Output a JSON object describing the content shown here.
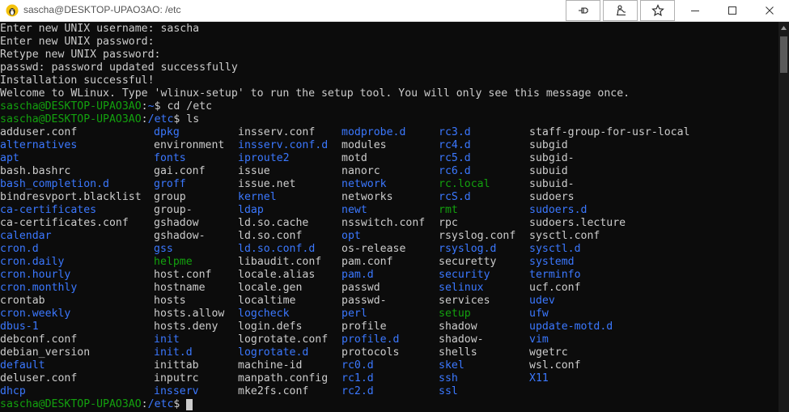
{
  "window": {
    "title": "sascha@DESKTOP-UPAO3AO: /etc",
    "title_buttons": [
      {
        "name": "pin-to-taskbar-button",
        "icon": "pin-icon"
      },
      {
        "name": "compact-overlay-button",
        "icon": "presenter-icon"
      },
      {
        "name": "favorite-button",
        "icon": "star-icon"
      }
    ],
    "controls": [
      "minimize",
      "maximize",
      "close"
    ]
  },
  "colors": {
    "background": "#0c0c0c",
    "text": "#cccccc",
    "user": "#13a10e",
    "path": "#3b78ff",
    "directory": "#3b78ff",
    "executable": "#13a10e"
  },
  "terminal": {
    "lines": [
      {
        "text": "Enter new UNIX username: sascha"
      },
      {
        "text": "Enter new UNIX password:"
      },
      {
        "text": "Retype new UNIX password:"
      },
      {
        "text": "passwd: password updated successfully"
      },
      {
        "text": "Installation successful!"
      },
      {
        "text": "Welcome to WLinux. Type 'wlinux-setup' to run the setup tool. You will only see this message once."
      }
    ],
    "prompts": [
      {
        "user": "sascha@DESKTOP-UPAO3AO",
        "sep": ":",
        "path": "~",
        "dollar": "$",
        "cmd": " cd /etc"
      },
      {
        "user": "sascha@DESKTOP-UPAO3AO",
        "sep": ":",
        "path": "/etc",
        "dollar": "$",
        "cmd": " ls"
      }
    ],
    "final_prompt": {
      "user": "sascha@DESKTOP-UPAO3AO",
      "sep": ":",
      "path": "/etc",
      "dollar": "$",
      "cmd": " "
    },
    "ls_rows": [
      [
        {
          "t": "adduser.conf",
          "k": "file"
        },
        {
          "t": "dpkg",
          "k": "dir"
        },
        {
          "t": "insserv.conf",
          "k": "file"
        },
        {
          "t": "modprobe.d",
          "k": "dir"
        },
        {
          "t": "rc3.d",
          "k": "dir"
        },
        {
          "t": "staff-group-for-usr-local",
          "k": "file"
        }
      ],
      [
        {
          "t": "alternatives",
          "k": "dir"
        },
        {
          "t": "environment",
          "k": "file"
        },
        {
          "t": "insserv.conf.d",
          "k": "dir"
        },
        {
          "t": "modules",
          "k": "file"
        },
        {
          "t": "rc4.d",
          "k": "dir"
        },
        {
          "t": "subgid",
          "k": "file"
        }
      ],
      [
        {
          "t": "apt",
          "k": "dir"
        },
        {
          "t": "fonts",
          "k": "dir"
        },
        {
          "t": "iproute2",
          "k": "dir"
        },
        {
          "t": "motd",
          "k": "file"
        },
        {
          "t": "rc5.d",
          "k": "dir"
        },
        {
          "t": "subgid-",
          "k": "file"
        }
      ],
      [
        {
          "t": "bash.bashrc",
          "k": "file"
        },
        {
          "t": "gai.conf",
          "k": "file"
        },
        {
          "t": "issue",
          "k": "file"
        },
        {
          "t": "nanorc",
          "k": "file"
        },
        {
          "t": "rc6.d",
          "k": "dir"
        },
        {
          "t": "subuid",
          "k": "file"
        }
      ],
      [
        {
          "t": "bash_completion.d",
          "k": "dir"
        },
        {
          "t": "groff",
          "k": "dir"
        },
        {
          "t": "issue.net",
          "k": "file"
        },
        {
          "t": "network",
          "k": "dir"
        },
        {
          "t": "rc.local",
          "k": "exe"
        },
        {
          "t": "subuid-",
          "k": "file"
        }
      ],
      [
        {
          "t": "bindresvport.blacklist",
          "k": "file"
        },
        {
          "t": "group",
          "k": "file"
        },
        {
          "t": "kernel",
          "k": "dir"
        },
        {
          "t": "networks",
          "k": "file"
        },
        {
          "t": "rcS.d",
          "k": "dir"
        },
        {
          "t": "sudoers",
          "k": "file"
        }
      ],
      [
        {
          "t": "ca-certificates",
          "k": "dir"
        },
        {
          "t": "group-",
          "k": "file"
        },
        {
          "t": "ldap",
          "k": "dir"
        },
        {
          "t": "newt",
          "k": "dir"
        },
        {
          "t": "rmt",
          "k": "exe"
        },
        {
          "t": "sudoers.d",
          "k": "dir"
        }
      ],
      [
        {
          "t": "ca-certificates.conf",
          "k": "file"
        },
        {
          "t": "gshadow",
          "k": "file"
        },
        {
          "t": "ld.so.cache",
          "k": "file"
        },
        {
          "t": "nsswitch.conf",
          "k": "file"
        },
        {
          "t": "rpc",
          "k": "file"
        },
        {
          "t": "sudoers.lecture",
          "k": "file"
        }
      ],
      [
        {
          "t": "calendar",
          "k": "dir"
        },
        {
          "t": "gshadow-",
          "k": "file"
        },
        {
          "t": "ld.so.conf",
          "k": "file"
        },
        {
          "t": "opt",
          "k": "dir"
        },
        {
          "t": "rsyslog.conf",
          "k": "file"
        },
        {
          "t": "sysctl.conf",
          "k": "file"
        }
      ],
      [
        {
          "t": "cron.d",
          "k": "dir"
        },
        {
          "t": "gss",
          "k": "dir"
        },
        {
          "t": "ld.so.conf.d",
          "k": "dir"
        },
        {
          "t": "os-release",
          "k": "file"
        },
        {
          "t": "rsyslog.d",
          "k": "dir"
        },
        {
          "t": "sysctl.d",
          "k": "dir"
        }
      ],
      [
        {
          "t": "cron.daily",
          "k": "dir"
        },
        {
          "t": "helpme",
          "k": "exe"
        },
        {
          "t": "libaudit.conf",
          "k": "file"
        },
        {
          "t": "pam.conf",
          "k": "file"
        },
        {
          "t": "securetty",
          "k": "file"
        },
        {
          "t": "systemd",
          "k": "dir"
        }
      ],
      [
        {
          "t": "cron.hourly",
          "k": "dir"
        },
        {
          "t": "host.conf",
          "k": "file"
        },
        {
          "t": "locale.alias",
          "k": "file"
        },
        {
          "t": "pam.d",
          "k": "dir"
        },
        {
          "t": "security",
          "k": "dir"
        },
        {
          "t": "terminfo",
          "k": "dir"
        }
      ],
      [
        {
          "t": "cron.monthly",
          "k": "dir"
        },
        {
          "t": "hostname",
          "k": "file"
        },
        {
          "t": "locale.gen",
          "k": "file"
        },
        {
          "t": "passwd",
          "k": "file"
        },
        {
          "t": "selinux",
          "k": "dir"
        },
        {
          "t": "ucf.conf",
          "k": "file"
        }
      ],
      [
        {
          "t": "crontab",
          "k": "file"
        },
        {
          "t": "hosts",
          "k": "file"
        },
        {
          "t": "localtime",
          "k": "file"
        },
        {
          "t": "passwd-",
          "k": "file"
        },
        {
          "t": "services",
          "k": "file"
        },
        {
          "t": "udev",
          "k": "dir"
        }
      ],
      [
        {
          "t": "cron.weekly",
          "k": "dir"
        },
        {
          "t": "hosts.allow",
          "k": "file"
        },
        {
          "t": "logcheck",
          "k": "dir"
        },
        {
          "t": "perl",
          "k": "dir"
        },
        {
          "t": "setup",
          "k": "exe"
        },
        {
          "t": "ufw",
          "k": "dir"
        }
      ],
      [
        {
          "t": "dbus-1",
          "k": "dir"
        },
        {
          "t": "hosts.deny",
          "k": "file"
        },
        {
          "t": "login.defs",
          "k": "file"
        },
        {
          "t": "profile",
          "k": "file"
        },
        {
          "t": "shadow",
          "k": "file"
        },
        {
          "t": "update-motd.d",
          "k": "dir"
        }
      ],
      [
        {
          "t": "debconf.conf",
          "k": "file"
        },
        {
          "t": "init",
          "k": "dir"
        },
        {
          "t": "logrotate.conf",
          "k": "file"
        },
        {
          "t": "profile.d",
          "k": "dir"
        },
        {
          "t": "shadow-",
          "k": "file"
        },
        {
          "t": "vim",
          "k": "dir"
        }
      ],
      [
        {
          "t": "debian_version",
          "k": "file"
        },
        {
          "t": "init.d",
          "k": "dir"
        },
        {
          "t": "logrotate.d",
          "k": "dir"
        },
        {
          "t": "protocols",
          "k": "file"
        },
        {
          "t": "shells",
          "k": "file"
        },
        {
          "t": "wgetrc",
          "k": "file"
        }
      ],
      [
        {
          "t": "default",
          "k": "dir"
        },
        {
          "t": "inittab",
          "k": "file"
        },
        {
          "t": "machine-id",
          "k": "file"
        },
        {
          "t": "rc0.d",
          "k": "dir"
        },
        {
          "t": "skel",
          "k": "dir"
        },
        {
          "t": "wsl.conf",
          "k": "file"
        }
      ],
      [
        {
          "t": "deluser.conf",
          "k": "file"
        },
        {
          "t": "inputrc",
          "k": "file"
        },
        {
          "t": "manpath.config",
          "k": "file"
        },
        {
          "t": "rc1.d",
          "k": "dir"
        },
        {
          "t": "ssh",
          "k": "dir"
        },
        {
          "t": "X11",
          "k": "dir"
        }
      ],
      [
        {
          "t": "dhcp",
          "k": "dir"
        },
        {
          "t": "insserv",
          "k": "dir"
        },
        {
          "t": "mke2fs.conf",
          "k": "file"
        },
        {
          "t": "rc2.d",
          "k": "dir"
        },
        {
          "t": "ssl",
          "k": "dir"
        },
        {
          "t": "",
          "k": "file"
        }
      ]
    ]
  }
}
